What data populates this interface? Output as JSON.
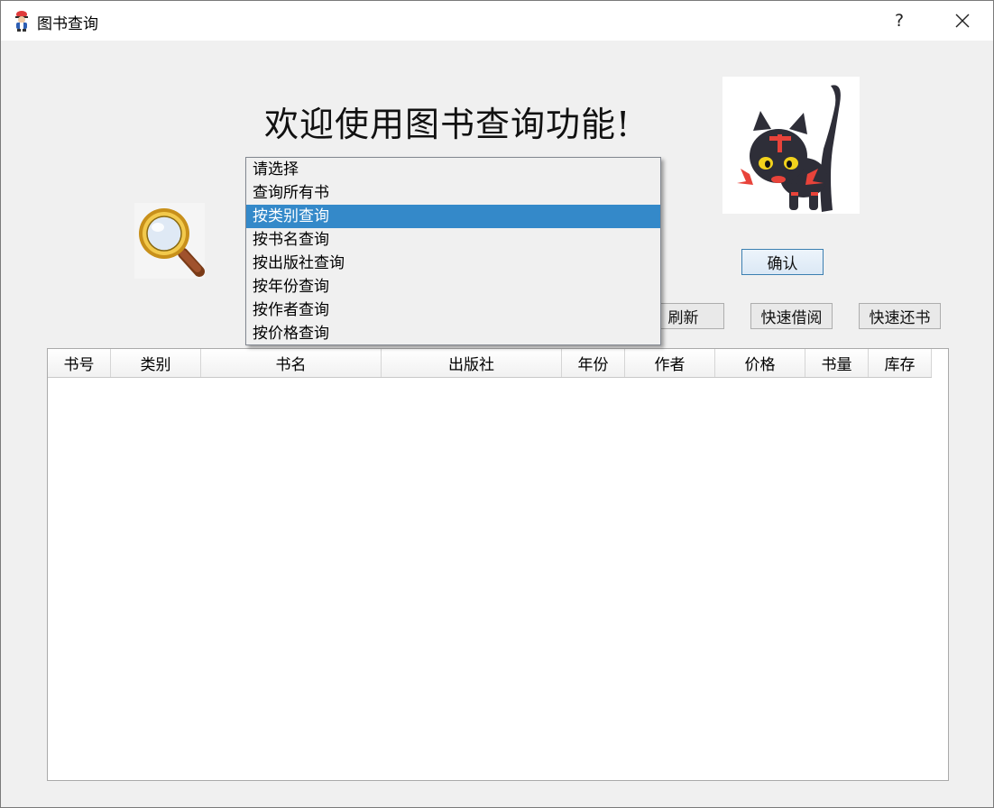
{
  "window": {
    "title": "图书查询",
    "help_label": "?"
  },
  "main": {
    "welcome": "欢迎使用图书查询功能!",
    "confirm_label": "确认",
    "refresh_label": "刷新",
    "quick_borrow_label": "快速借阅",
    "quick_return_label": "快速还书"
  },
  "query_dropdown": {
    "options": [
      "请选择",
      "查询所有书",
      "按类别查询",
      "按书名查询",
      "按出版社查询",
      "按年份查询",
      "按作者查询",
      "按价格查询"
    ],
    "highlighted": "按类别查询"
  },
  "table": {
    "columns": [
      "书号",
      "类别",
      "书名",
      "出版社",
      "年份",
      "作者",
      "价格",
      "书量",
      "库存"
    ],
    "rows": []
  },
  "icons": {
    "app": "trainer-icon",
    "magnifier": "magnifier-icon",
    "mascot": "litten-cat-image",
    "close": "close-icon"
  },
  "colors": {
    "selection": "#3489c9",
    "titlebar": "#ffffff",
    "background": "#f0f0f0"
  }
}
